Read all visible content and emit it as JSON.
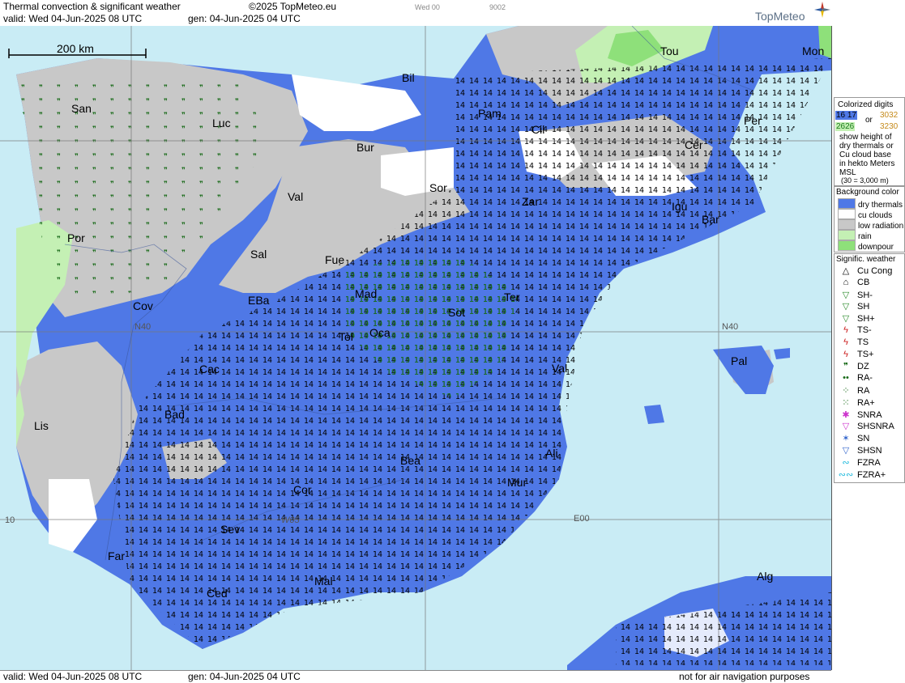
{
  "header": {
    "title": "Thermal convection & significant weather",
    "copyright": "©2025 TopMeteo.eu",
    "valid": "valid:  Wed  04-Jun-2025  08 UTC",
    "gen": "gen: 04-Jun-2025 04 UTC",
    "small1": "Wed 00",
    "small2": "9002",
    "logo": "TopMeteo"
  },
  "footer": {
    "valid": "valid:  Wed  04-Jun-2025  08 UTC",
    "gen": "gen: 04-Jun-2025 04 UTC",
    "note": "not for air navigation purposes"
  },
  "scale": {
    "label": "200 km"
  },
  "grid_labels": {
    "n40_left": "N40",
    "n40_right": "N40",
    "w05": "W05",
    "e00": "E00",
    "w10": "10"
  },
  "cities": [
    {
      "name": "San"
    },
    {
      "name": "Luc"
    },
    {
      "name": "Bil"
    },
    {
      "name": "Pam"
    },
    {
      "name": "Bur"
    },
    {
      "name": "Cil"
    },
    {
      "name": "Tou"
    },
    {
      "name": "Mon"
    },
    {
      "name": "Per"
    },
    {
      "name": "Cer"
    },
    {
      "name": "Val"
    },
    {
      "name": "Sor"
    },
    {
      "name": "Zar"
    },
    {
      "name": "Igu"
    },
    {
      "name": "Bar"
    },
    {
      "name": "Por"
    },
    {
      "name": "Sal"
    },
    {
      "name": "Fue"
    },
    {
      "name": "Cov"
    },
    {
      "name": "EBa"
    },
    {
      "name": "Mad"
    },
    {
      "name": "Ter"
    },
    {
      "name": "Sot"
    },
    {
      "name": "Tol"
    },
    {
      "name": "Oca"
    },
    {
      "name": "Pal"
    },
    {
      "name": "Cac"
    },
    {
      "name": "Val"
    },
    {
      "name": "Bad"
    },
    {
      "name": "Lis"
    },
    {
      "name": "Ali"
    },
    {
      "name": "Bea"
    },
    {
      "name": "Mur"
    },
    {
      "name": "Cor"
    },
    {
      "name": "Sev"
    },
    {
      "name": "Far"
    },
    {
      "name": "Mal"
    },
    {
      "name": "Ced"
    },
    {
      "name": "Alg"
    }
  ],
  "legend": {
    "colorized_title": "Colorized digits",
    "digits_blue": "16 17",
    "or": "or",
    "digits_orange1": "3032",
    "digits_green": "2626",
    "digits_orange2": "3230",
    "desc1": "show height of",
    "desc2": "dry thermals or",
    "desc3": "Cu cloud base",
    "desc4": "in hekto Meters",
    "desc5": "MSL",
    "desc6": "(30 = 3,000 m)",
    "bg_title": "Background color",
    "bg_items": [
      {
        "label": "dry thermals",
        "color": "#4f78e6"
      },
      {
        "label": "cu clouds",
        "color": "#ffffff"
      },
      {
        "label": "low radiation",
        "color": "#c8c8c8"
      },
      {
        "label": "rain",
        "color": "#c4f0b4"
      },
      {
        "label": "downpour",
        "color": "#8ee07a"
      }
    ],
    "sig_title": "Signific. weather",
    "sig_items": [
      {
        "label": "Cu Cong",
        "symbol": "△",
        "color": "#000000"
      },
      {
        "label": "CB",
        "symbol": "⌂",
        "color": "#000000"
      },
      {
        "label": "SH-",
        "symbol": "▽",
        "color": "#2a8a2a"
      },
      {
        "label": "SH",
        "symbol": "▽",
        "color": "#2a8a2a"
      },
      {
        "label": "SH+",
        "symbol": "▽",
        "color": "#2a8a2a"
      },
      {
        "label": "TS-",
        "symbol": "ϟ",
        "color": "#cc2222"
      },
      {
        "label": "TS",
        "symbol": "ϟ",
        "color": "#cc2222"
      },
      {
        "label": "TS+",
        "symbol": "ϟ",
        "color": "#cc2222"
      },
      {
        "label": "DZ",
        "symbol": "❞",
        "color": "#1a6b1a"
      },
      {
        "label": "RA-",
        "symbol": "••",
        "color": "#1a6b1a"
      },
      {
        "label": "RA",
        "symbol": "⁘",
        "color": "#1a6b1a"
      },
      {
        "label": "RA+",
        "symbol": "⁙",
        "color": "#1a6b1a"
      },
      {
        "label": "SNRA",
        "symbol": "✱",
        "color": "#cc33cc"
      },
      {
        "label": "SHSNRA",
        "symbol": "▽",
        "color": "#cc33cc"
      },
      {
        "label": "SN",
        "symbol": "✶",
        "color": "#3366cc"
      },
      {
        "label": "SHSN",
        "symbol": "▽",
        "color": "#3366cc"
      },
      {
        "label": "FZRA",
        "symbol": "∾",
        "color": "#22bbdd"
      },
      {
        "label": "FZRA+",
        "symbol": "∾∾",
        "color": "#22bbdd"
      }
    ]
  },
  "colors": {
    "sea": "#c9ecf5",
    "dry_thermals": "#4f78e6",
    "cu_clouds": "#ffffff",
    "low_radiation": "#c8c8c8",
    "rain": "#c4f0b4",
    "downpour": "#8ee07a"
  }
}
